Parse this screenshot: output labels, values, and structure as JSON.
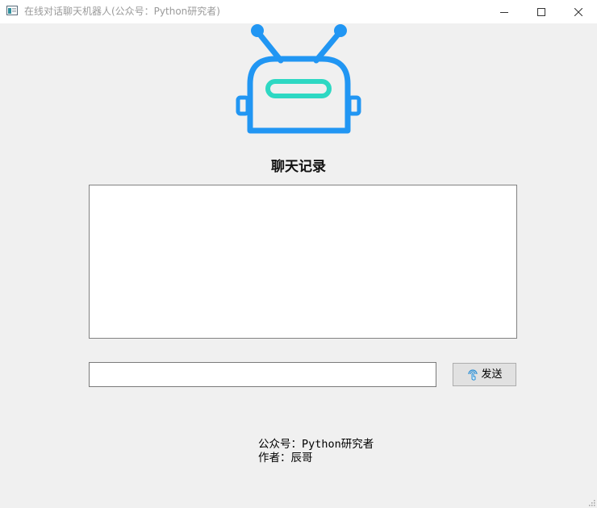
{
  "window": {
    "title": "在线对话聊天机器人(公众号：Python研究者)",
    "controls": [
      "minimize-icon",
      "maximize-icon",
      "close-icon"
    ]
  },
  "logo": {
    "icon": "robot-icon",
    "colors": {
      "body": "#2196f3",
      "visor": "#2ed8c3"
    }
  },
  "chat": {
    "history_label": "聊天记录",
    "history_text": "",
    "input_value": "",
    "send_label": "发送",
    "send_icon": "touch-hand-icon"
  },
  "info": {
    "account_line": "公众号：Python研究者",
    "author_line": "作者：辰哥"
  }
}
